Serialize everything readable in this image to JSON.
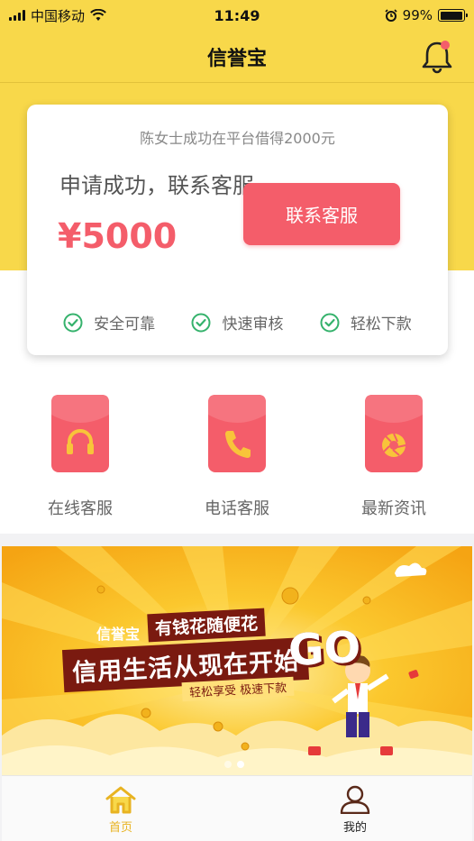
{
  "status_bar": {
    "carrier": "中国移动",
    "time": "11:49",
    "battery": "99%",
    "battery_level": 0.99
  },
  "header": {
    "title": "信誉宝",
    "right_icon": "bell-icon"
  },
  "card": {
    "notice": "陈女士成功在平台借得2000元",
    "headline": "申请成功，联系客服",
    "amount": "¥5000",
    "button_label": "联系客服",
    "features": [
      "安全可靠",
      "快速审核",
      "轻松下款"
    ]
  },
  "quick_links": [
    {
      "label": "在线客服",
      "icon": "headset-icon"
    },
    {
      "label": "电话客服",
      "icon": "phone-icon"
    },
    {
      "label": "最新资讯",
      "icon": "aperture-icon"
    }
  ],
  "banner": {
    "brand": "信誉宝",
    "slogan": "有钱花随便花",
    "main_text": "信用生活从现在开始",
    "go_text": "GO",
    "sub_text": "轻松享受 极速下款",
    "slide_count": 2,
    "active_slide": 1
  },
  "tabbar": {
    "items": [
      {
        "label": "首页",
        "icon": "home-icon",
        "active": true
      },
      {
        "label": "我的",
        "icon": "user-icon",
        "active": false
      }
    ]
  },
  "colors": {
    "brand_yellow": "#f8d84a",
    "accent_red": "#f45d6a",
    "check_green": "#35b26c",
    "tab_active": "#e8b321",
    "tab_inactive": "#5a2a1a"
  }
}
